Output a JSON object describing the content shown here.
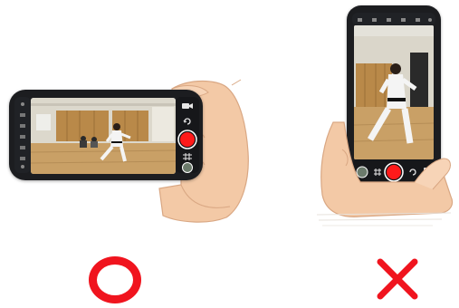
{
  "good_example": {
    "orientation": "landscape",
    "verdict_symbol": "circle",
    "verdict_color": "#f0141e",
    "record_button_color": "#ff1a1a"
  },
  "bad_example": {
    "orientation": "portrait",
    "verdict_symbol": "cross",
    "verdict_color": "#f0141e",
    "record_button_color": "#ff1a1a"
  },
  "icons": [
    "video-camera-icon",
    "rotate-camera-icon",
    "grid-icon",
    "gallery-thumbnail-icon",
    "settings-icon"
  ]
}
